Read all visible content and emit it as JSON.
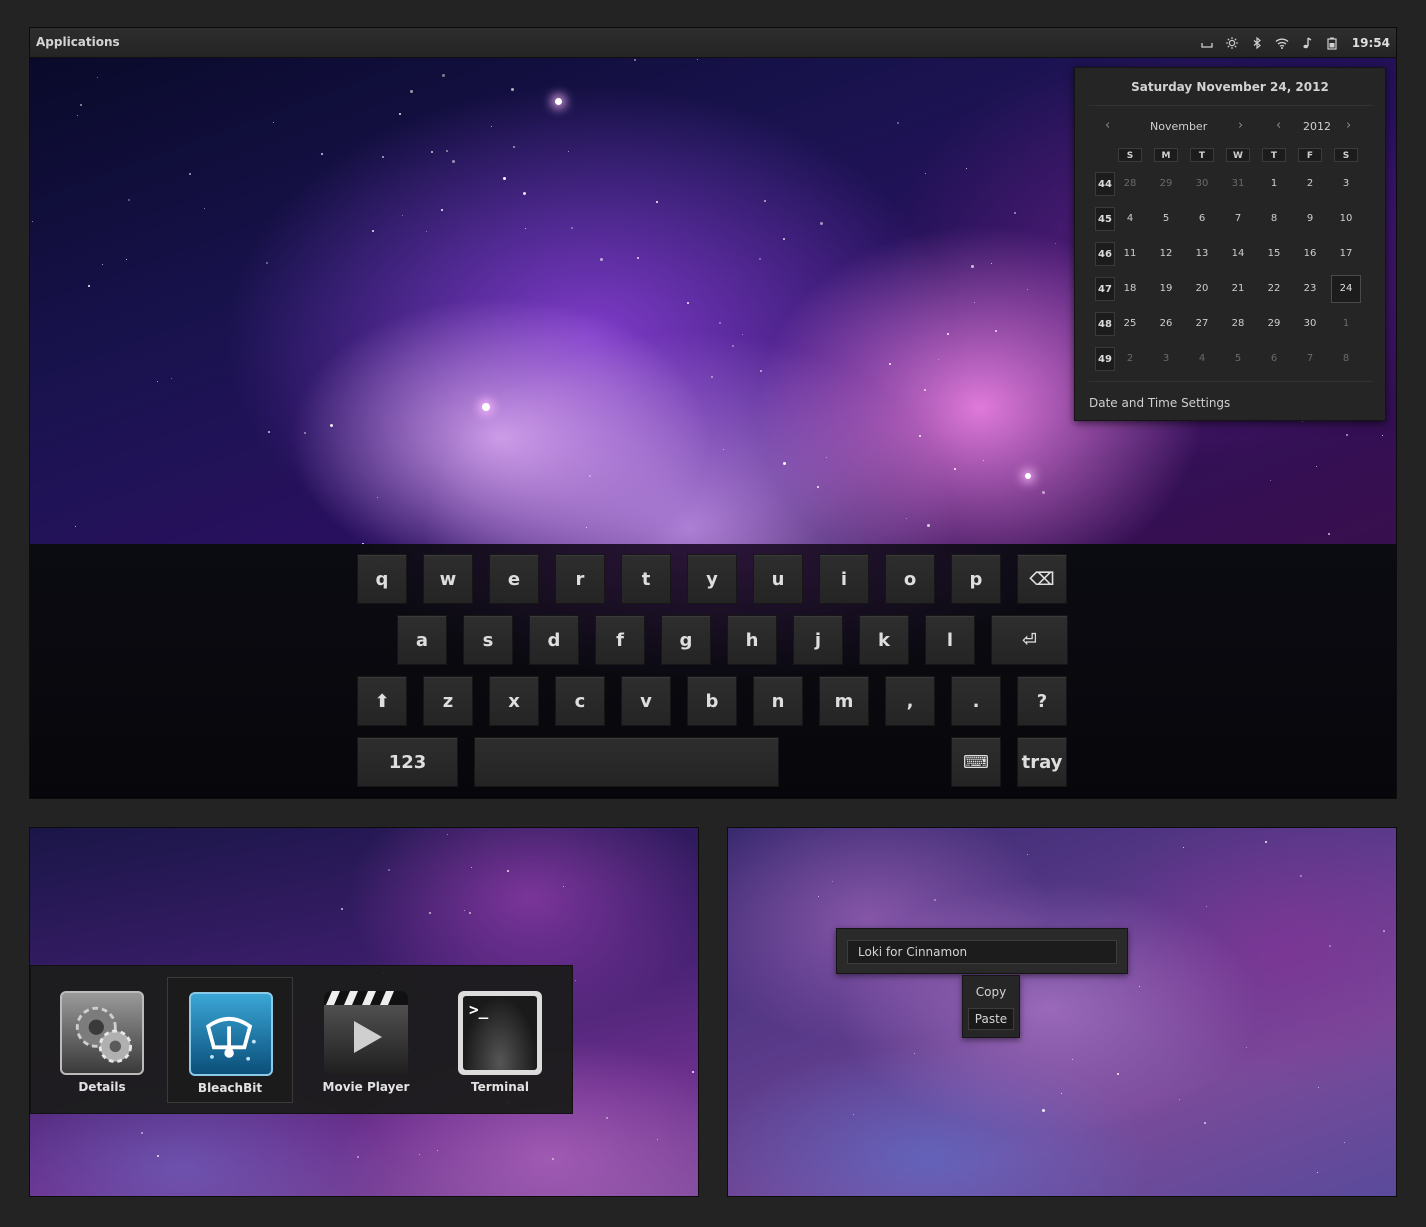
{
  "panel": {
    "applications_label": "Applications",
    "clock": "19:54",
    "tray_icons": [
      "keyboard-icon",
      "brightness-icon",
      "bluetooth-icon",
      "wifi-icon",
      "sound-icon",
      "battery-icon"
    ]
  },
  "calendar": {
    "date_heading": "Saturday November 24, 2012",
    "month": "November",
    "year": "2012",
    "weekdays": [
      "S",
      "M",
      "T",
      "W",
      "T",
      "F",
      "S"
    ],
    "weeks": [
      {
        "num": "44",
        "days": [
          "28",
          "29",
          "30",
          "31",
          "1",
          "2",
          "3"
        ],
        "other": [
          true,
          true,
          true,
          true,
          false,
          false,
          false
        ]
      },
      {
        "num": "45",
        "days": [
          "4",
          "5",
          "6",
          "7",
          "8",
          "9",
          "10"
        ],
        "other": [
          false,
          false,
          false,
          false,
          false,
          false,
          false
        ]
      },
      {
        "num": "46",
        "days": [
          "11",
          "12",
          "13",
          "14",
          "15",
          "16",
          "17"
        ],
        "other": [
          false,
          false,
          false,
          false,
          false,
          false,
          false
        ]
      },
      {
        "num": "47",
        "days": [
          "18",
          "19",
          "20",
          "21",
          "22",
          "23",
          "24"
        ],
        "other": [
          false,
          false,
          false,
          false,
          false,
          false,
          false
        ]
      },
      {
        "num": "48",
        "days": [
          "25",
          "26",
          "27",
          "28",
          "29",
          "30",
          "1"
        ],
        "other": [
          false,
          false,
          false,
          false,
          false,
          false,
          true
        ]
      },
      {
        "num": "49",
        "days": [
          "2",
          "3",
          "4",
          "5",
          "6",
          "7",
          "8"
        ],
        "other": [
          true,
          true,
          true,
          true,
          true,
          true,
          true
        ]
      }
    ],
    "today": "24",
    "settings_label": "Date and Time Settings"
  },
  "keyboard": {
    "row1": [
      "q",
      "w",
      "e",
      "r",
      "t",
      "y",
      "u",
      "i",
      "o",
      "p",
      "⌫"
    ],
    "row2": [
      "a",
      "s",
      "d",
      "f",
      "g",
      "h",
      "j",
      "k",
      "l",
      "⏎"
    ],
    "row3": [
      "⬆",
      "z",
      "x",
      "c",
      "v",
      "b",
      "n",
      "m",
      ",",
      ".",
      "?"
    ],
    "numbers_label": "123",
    "keyboard_glyph": "⌨",
    "tray_label": "tray"
  },
  "switcher": {
    "items": [
      {
        "label": "Details",
        "icon": "gears-icon"
      },
      {
        "label": "BleachBit",
        "icon": "bleachbit-icon"
      },
      {
        "label": "Movie Player",
        "icon": "clapperboard-icon"
      },
      {
        "label": "Terminal",
        "icon": "terminal-icon"
      }
    ],
    "selected_label": "BleachBit"
  },
  "entry": {
    "value": "Loki for Cinnamon"
  },
  "context_menu": {
    "items": [
      "Copy",
      "Paste"
    ],
    "hovered": "Paste"
  },
  "colors": {
    "panel_bg": "#262626",
    "key_bg": "#2a2a2a",
    "wallpaper_pink": "#f08cf0",
    "wallpaper_purple": "#9646e6"
  }
}
